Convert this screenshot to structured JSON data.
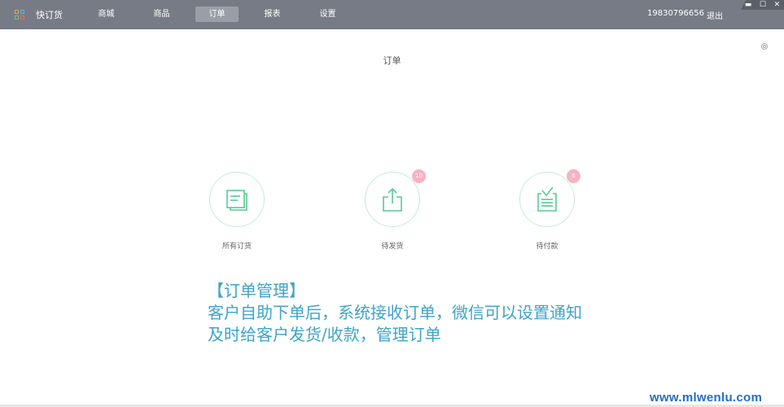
{
  "app": {
    "name": "快订货"
  },
  "nav": [
    {
      "label": "商城",
      "active": false
    },
    {
      "label": "商品",
      "active": false
    },
    {
      "label": "订单",
      "active": true
    },
    {
      "label": "报表",
      "active": false
    },
    {
      "label": "设置",
      "active": false
    }
  ],
  "user": {
    "phone": "19830796656",
    "logout_label": "退出"
  },
  "window_controls": {
    "minimize": "▬",
    "maximize": "☐",
    "close": "✕"
  },
  "page": {
    "title": "订单"
  },
  "cards": [
    {
      "label": "所有订货",
      "badge": "",
      "icon": "document-icon"
    },
    {
      "label": "待发货",
      "badge": "10",
      "icon": "share-upload-icon"
    },
    {
      "label": "待付款",
      "badge": "6",
      "icon": "checklist-icon"
    }
  ],
  "annotation": {
    "line1": "【订单管理】",
    "line2": "客户自助下单后，系统接收订单，微信可以设置通知",
    "line3": "及时给客户发货/收款，管理订单"
  },
  "watermark": "www.mlwenlu.com",
  "colors": {
    "topbar": "#777b85",
    "nav_active": "#9a9ea7",
    "icon_green": "#58c996",
    "badge": "#f6b3c2",
    "annotation": "#3fa3c9",
    "watermark": "#1e6fc6"
  }
}
